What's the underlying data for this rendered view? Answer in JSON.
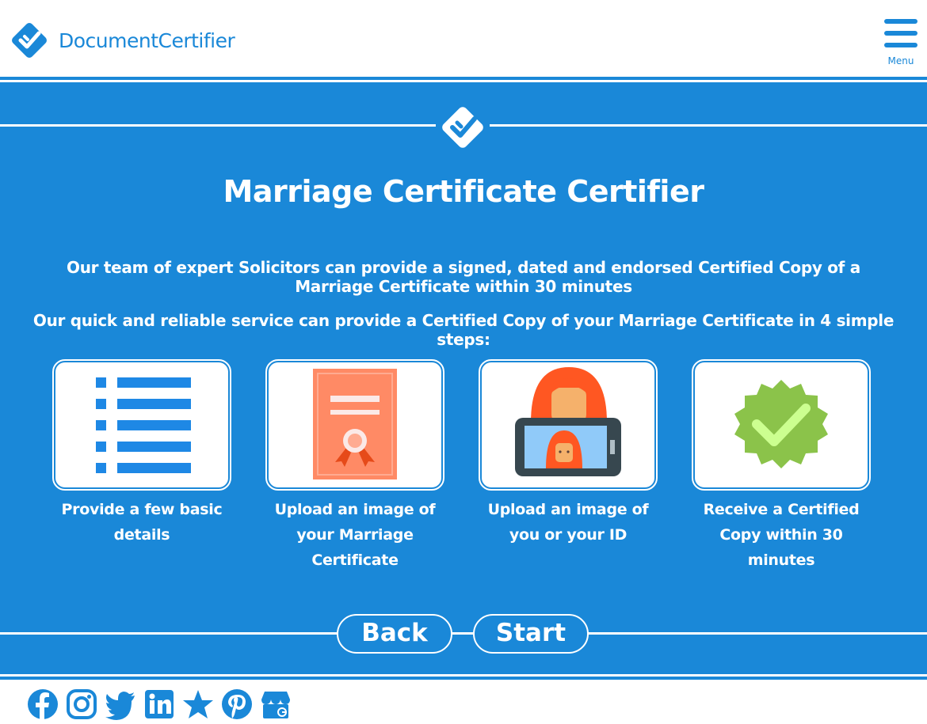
{
  "header": {
    "brand": "DocumentCertifier",
    "menu_label": "Menu"
  },
  "main": {
    "title": "Marriage Certificate Certifier",
    "intro": "Our team of expert Solicitors can provide a signed, dated and endorsed Certified Copy of a Marriage Certificate within 30 minutes",
    "steps_intro": "Our quick and reliable service can provide a Certified Copy of your Marriage Certificate in 4 simple steps:",
    "steps": [
      {
        "label": "Provide a few basic details",
        "icon": "list-icon"
      },
      {
        "label": "Upload an image of your Marriage Certificate",
        "icon": "certificate-icon"
      },
      {
        "label": "Upload an image of you or your ID",
        "icon": "selfie-phone-icon"
      },
      {
        "label": "Receive a Certified Copy within 30 minutes",
        "icon": "verified-badge-icon"
      }
    ],
    "back_label": "Back",
    "start_label": "Start"
  },
  "social": [
    "facebook-icon",
    "instagram-icon",
    "twitter-icon",
    "linkedin-icon",
    "star-icon",
    "pinterest-icon",
    "google-business-icon"
  ],
  "colors": {
    "brand_blue": "#1a88d8",
    "white": "#ffffff",
    "certificate_salmon": "#ff8a65",
    "badge_green": "#8bc34a"
  }
}
